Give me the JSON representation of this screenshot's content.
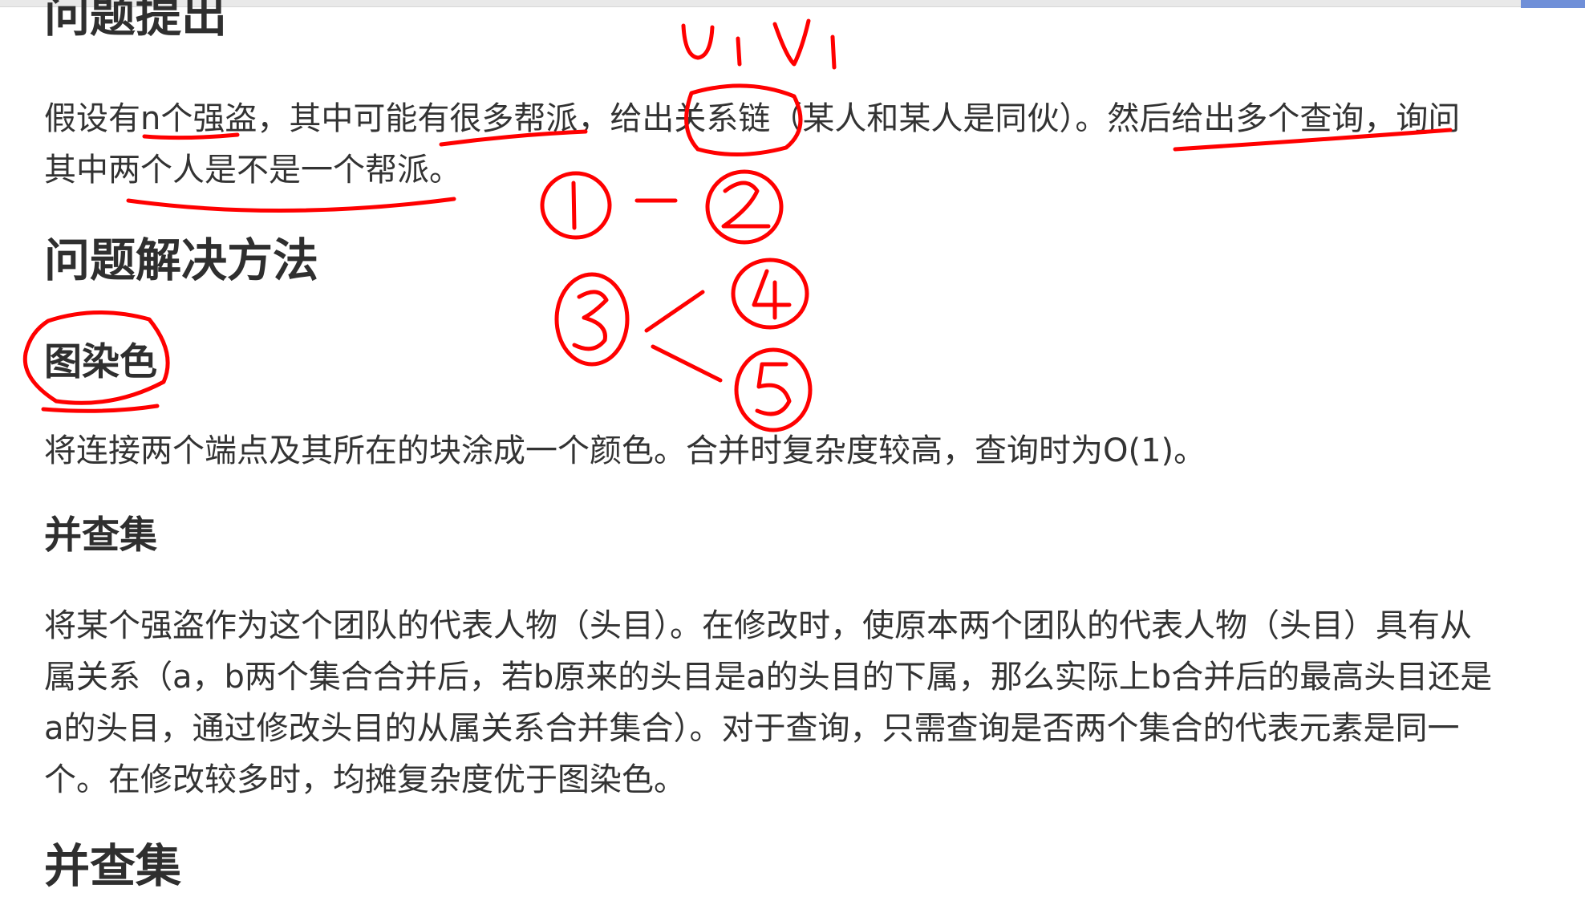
{
  "document": {
    "heading_problem": "问题提出",
    "problem_line1": "假设有n个强盗，其中可能有很多帮派，给出关系链（某人和某人是同伙）。然后给出多个查询，询问",
    "problem_line2": "其中两个人是不是一个帮派。",
    "heading_solution": "问题解决方法",
    "heading_coloring": "图染色",
    "coloring_text": "将连接两个端点及其所在的块涂成一个颜色。合并时复杂度较高，查询时为O(1)。",
    "heading_union_find": "并查集",
    "uf_line1": "将某个强盗作为这个团队的代表人物（头目）。在修改时，使原本两个团队的代表人物（头目）具有从",
    "uf_line2": "属关系（a，b两个集合合并后，若b原来的头目是a的头目的下属，那么实际上b合并后的最高头目还是",
    "uf_line3": "a的头目，通过修改头目的从属关系合并集合）。对于查询，只需查询是否两个集合的代表元素是同一",
    "uf_line4": "个。在修改较多时，均摊复杂度优于图染色。",
    "heading_union_find_2": "并查集"
  },
  "annotations": {
    "ink_color": "#ff0000",
    "uv_label": "Ui Vi",
    "nodes": [
      "1",
      "2",
      "3",
      "4",
      "5"
    ]
  }
}
